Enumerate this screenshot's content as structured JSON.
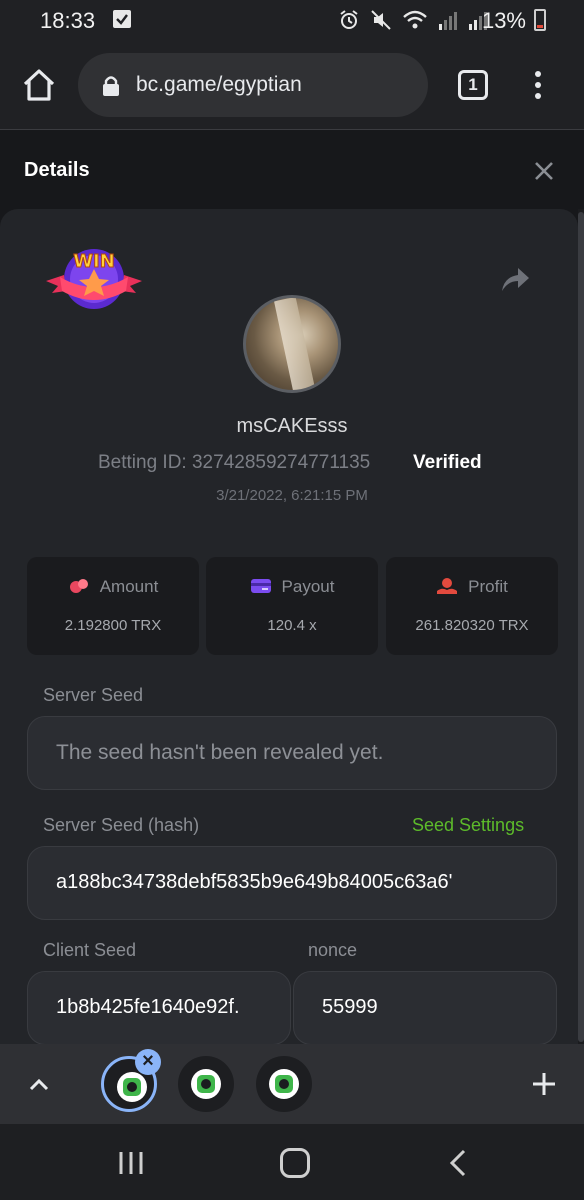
{
  "status": {
    "time": "18:33",
    "battery": "13%"
  },
  "browser": {
    "url": "bc.game/egyptian",
    "tab_count": "1"
  },
  "details": {
    "title": "Details",
    "badge_text": "WIN",
    "username": "msCAKEsss",
    "betting_id": "Betting ID: 32742859274771135",
    "verified": "Verified",
    "timestamp": "3/21/2022, 6:21:15 PM",
    "stats": [
      {
        "label": "Amount",
        "value": "2.192800 TRX",
        "icon": "coins-icon",
        "color": "#e8475f"
      },
      {
        "label": "Payout",
        "value": "120.4 x",
        "icon": "card-icon",
        "color": "#7b4cf0"
      },
      {
        "label": "Profit",
        "value": "261.820320 TRX",
        "icon": "hand-coin-icon",
        "color": "#e34a3e"
      }
    ],
    "server_seed_label": "Server Seed",
    "server_seed_placeholder": "The seed hasn't been revealed yet.",
    "server_seed_hash_label": "Server Seed (hash)",
    "seed_settings": "Seed Settings",
    "server_seed_hash": "a188bc34738debf5835b9e649b84005c63a6'",
    "client_seed_label": "Client Seed",
    "client_seed": "1b8b425fe1640e92f.",
    "nonce_label": "nonce",
    "nonce": "55999"
  },
  "colors": {
    "accent_green": "#5dbb2a",
    "tab_highlight": "#8ab4f8"
  }
}
